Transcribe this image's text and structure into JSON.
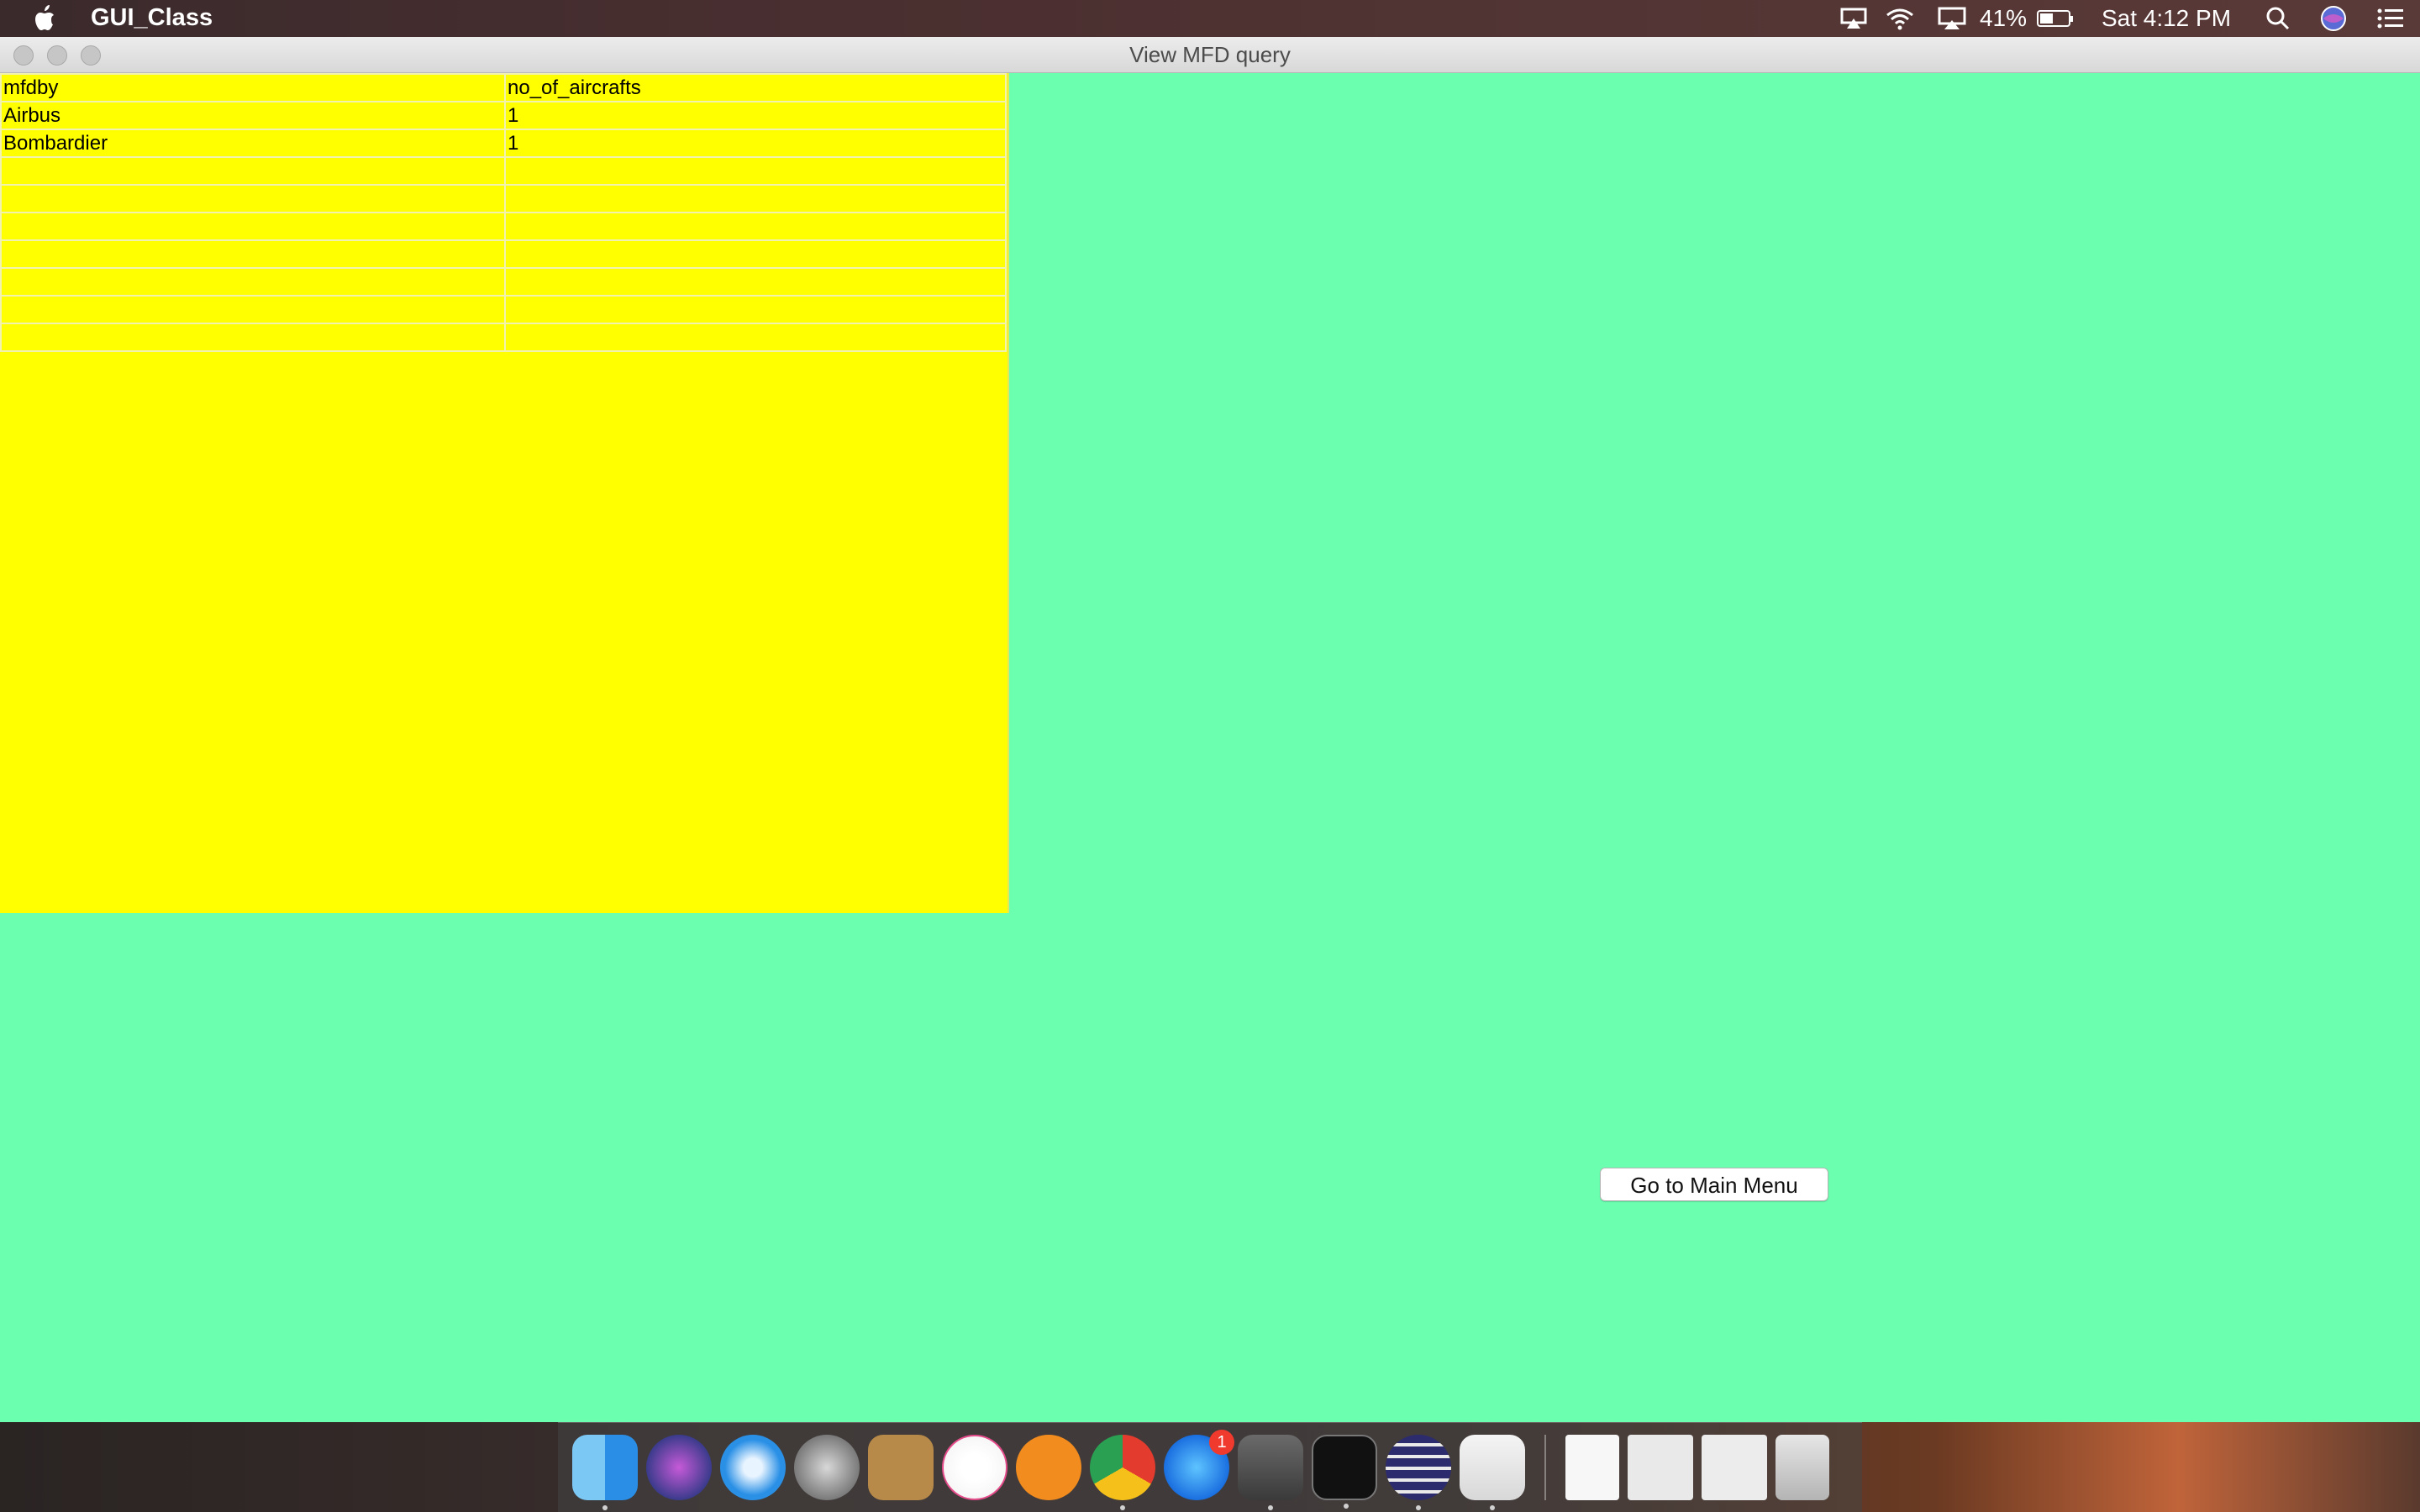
{
  "menubar": {
    "app_name": "GUI_Class",
    "battery": "41%",
    "clock": "Sat 4:12 PM"
  },
  "window": {
    "title": "View MFD query"
  },
  "table": {
    "columns": [
      "mfdby",
      "no_of_aircrafts"
    ],
    "rows": [
      [
        "Airbus",
        "1"
      ],
      [
        "Bombardier",
        "1"
      ],
      [
        "",
        ""
      ],
      [
        "",
        ""
      ],
      [
        "",
        ""
      ],
      [
        "",
        ""
      ],
      [
        "",
        ""
      ],
      [
        "",
        ""
      ],
      [
        "",
        ""
      ]
    ]
  },
  "actions": {
    "main_menu_label": "Go to Main Menu"
  },
  "dock": {
    "app_store_badge": "1"
  },
  "colors": {
    "window_background": "#6bffb0",
    "table_background": "#ffff00"
  }
}
